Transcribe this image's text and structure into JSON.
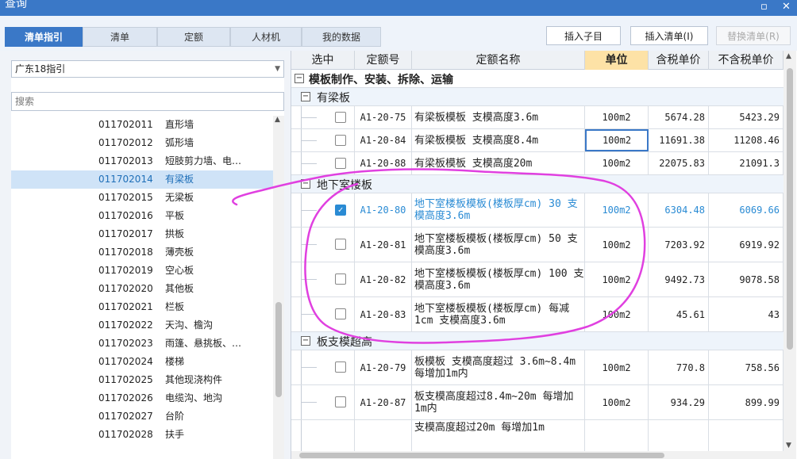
{
  "window": {
    "title": "查询",
    "minimize_glyph": "▫",
    "close_glyph": "✕"
  },
  "tabs": [
    "清单指引",
    "清单",
    "定额",
    "人材机",
    "我的数据"
  ],
  "toolbar": {
    "insert_child": "插入子目",
    "insert_list": "插入清单(I)",
    "replace_list": "替换清单(R)"
  },
  "left": {
    "combo_value": "广东18指引",
    "search_placeholder": "搜索",
    "items": [
      {
        "code": "011702011",
        "name": "直形墙"
      },
      {
        "code": "011702012",
        "name": "弧形墙"
      },
      {
        "code": "011702013",
        "name": "短肢剪力墙、电…"
      },
      {
        "code": "011702014",
        "name": "有梁板"
      },
      {
        "code": "011702015",
        "name": "无梁板"
      },
      {
        "code": "011702016",
        "name": "平板"
      },
      {
        "code": "011702017",
        "name": "拱板"
      },
      {
        "code": "011702018",
        "name": "薄壳板"
      },
      {
        "code": "011702019",
        "name": "空心板"
      },
      {
        "code": "011702020",
        "name": "其他板"
      },
      {
        "code": "011702021",
        "name": "栏板"
      },
      {
        "code": "011702022",
        "name": "天沟、檐沟"
      },
      {
        "code": "011702023",
        "name": "雨篷、悬挑板、…"
      },
      {
        "code": "011702024",
        "name": "楼梯"
      },
      {
        "code": "011702025",
        "name": "其他现浇构件"
      },
      {
        "code": "011702026",
        "name": "电缆沟、地沟"
      },
      {
        "code": "011702027",
        "name": "台阶"
      },
      {
        "code": "011702028",
        "name": "扶手"
      }
    ]
  },
  "table": {
    "headers": [
      "选中",
      "定额号",
      "定额名称",
      "单位",
      "含税单价",
      "不含税单价"
    ],
    "top_group": "模板制作、安装、拆除、运输",
    "groups": [
      {
        "name": "有梁板",
        "rows": [
          {
            "code": "A1-20-75",
            "name": "有梁板模板 支模高度3.6m",
            "unit": "100m2",
            "p1": "5674.28",
            "p2": "5423.29",
            "checked": false
          },
          {
            "code": "A1-20-84",
            "name": "有梁板模板 支模高度8.4m",
            "unit": "100m2",
            "p1": "11691.38",
            "p2": "11208.46",
            "checked": false
          },
          {
            "code": "A1-20-88",
            "name": "有梁板模板 支模高度20m",
            "unit": "100m2",
            "p1": "22075.83",
            "p2": "21091.3",
            "checked": false
          }
        ]
      },
      {
        "name": "地下室楼板",
        "rows": [
          {
            "code": "A1-20-80",
            "name": "地下室楼板模板(楼板厚cm) 30 支模高度3.6m",
            "unit": "100m2",
            "p1": "6304.48",
            "p2": "6069.66",
            "checked": true
          },
          {
            "code": "A1-20-81",
            "name": "地下室楼板模板(楼板厚cm) 50 支模高度3.6m",
            "unit": "100m2",
            "p1": "7203.92",
            "p2": "6919.92",
            "checked": false
          },
          {
            "code": "A1-20-82",
            "name": "地下室楼板模板(楼板厚cm) 100 支模高度3.6m",
            "unit": "100m2",
            "p1": "9492.73",
            "p2": "9078.58",
            "checked": false
          },
          {
            "code": "A1-20-83",
            "name": "地下室楼板模板(楼板厚cm) 每减1cm 支模高度3.6m",
            "unit": "100m2",
            "p1": "45.61",
            "p2": "43",
            "checked": false
          }
        ]
      },
      {
        "name": "板支模超高",
        "rows": [
          {
            "code": "A1-20-79",
            "name": "板模板 支模高度超过 3.6m~8.4m 每增加1m内",
            "unit": "100m2",
            "p1": "770.8",
            "p2": "758.56",
            "checked": false
          },
          {
            "code": "A1-20-87",
            "name": "板支模高度超过8.4m~20m 每增加1m内",
            "unit": "100m2",
            "p1": "934.29",
            "p2": "899.99",
            "checked": false
          },
          {
            "code": "",
            "name": "支模高度超过20m 每增加1m",
            "unit": "",
            "p1": "",
            "p2": "",
            "checked": false
          }
        ]
      }
    ]
  },
  "colors": {
    "accent": "#3a78c7",
    "selected_text": "#2a8bd4",
    "annotation": "#e040e0",
    "header_highlight": "#fde2a6"
  }
}
